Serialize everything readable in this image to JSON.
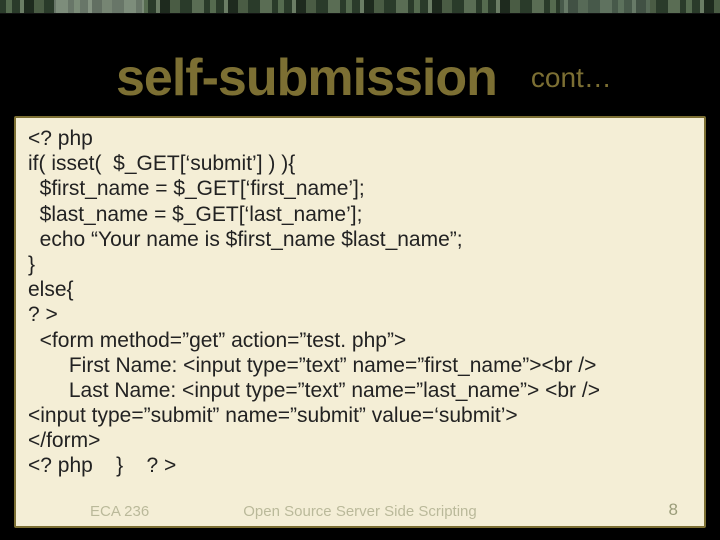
{
  "title": {
    "main": "self-submission",
    "sub": "cont…"
  },
  "code_lines": [
    "<? php",
    "if( isset(  $_GET[‘submit’] ) ){",
    "  $first_name = $_GET[‘first_name’];",
    "  $last_name = $_GET[‘last_name’];",
    "  echo “Your name is $first_name $last_name”;",
    "}",
    "else{",
    "? >",
    "  <form method=”get” action=”test. php”>",
    "       First Name: <input type=”text” name=”first_name”><br />",
    "       Last Name: <input type=”text” name=”last_name”> <br />",
    "<input type=”submit” name=”submit” value=‘submit’>",
    "</form>",
    "<? php    }    ? >"
  ],
  "footer": {
    "left": "ECA 236",
    "center": "Open Source Server Side Scripting",
    "right": "8"
  }
}
